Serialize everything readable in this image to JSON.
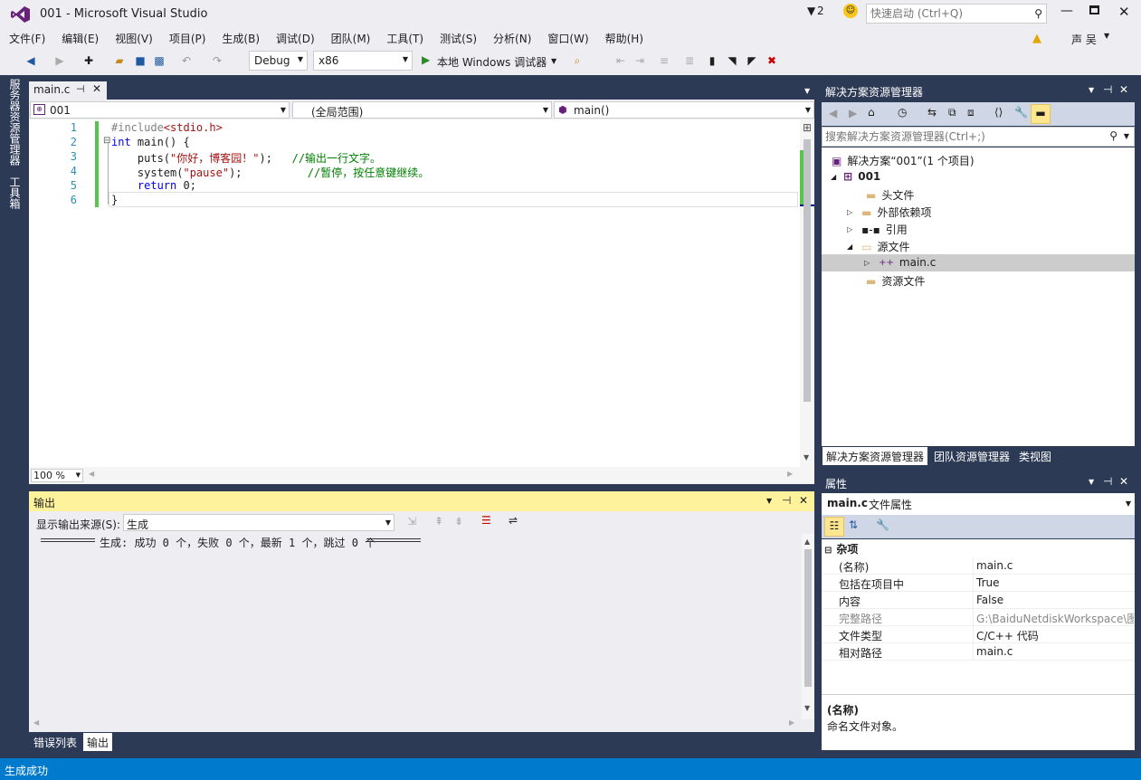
{
  "window": {
    "title": "001 - Microsoft Visual Studio",
    "notif_count": "2",
    "quick_launch_placeholder": "快速启动 (Ctrl+Q)",
    "user": "声 吴"
  },
  "menu": [
    "文件(F)",
    "编辑(E)",
    "视图(V)",
    "项目(P)",
    "生成(B)",
    "调试(D)",
    "团队(M)",
    "工具(T)",
    "测试(S)",
    "分析(N)",
    "窗口(W)",
    "帮助(H)"
  ],
  "toolbar": {
    "config": "Debug",
    "platform": "x86",
    "run_label": "本地 Windows 调试器"
  },
  "left_tabs": [
    "服务器资源管理器",
    "工具箱"
  ],
  "editor": {
    "tab": "main.c",
    "nav_project": "001",
    "nav_scope": "(全局范围)",
    "nav_func": "main()",
    "zoom": "100 %",
    "lines": [
      {
        "n": "1",
        "parts": [
          {
            "t": "#include",
            "c": "pp"
          },
          {
            "t": "<stdio.h>",
            "c": "str"
          }
        ]
      },
      {
        "n": "2",
        "parts": [
          {
            "t": "int",
            "c": "kw"
          },
          {
            "t": " main() {",
            "c": ""
          }
        ]
      },
      {
        "n": "3",
        "parts": [
          {
            "t": "    puts(",
            "c": ""
          },
          {
            "t": "\"你好，博客园！\"",
            "c": "str"
          },
          {
            "t": ");   ",
            "c": ""
          },
          {
            "t": "//输出一行文字。",
            "c": "cm"
          }
        ]
      },
      {
        "n": "4",
        "parts": [
          {
            "t": "    system(",
            "c": ""
          },
          {
            "t": "\"pause\"",
            "c": "str"
          },
          {
            "t": ");          ",
            "c": ""
          },
          {
            "t": "//暂停，按任意键继续。",
            "c": "cm"
          }
        ]
      },
      {
        "n": "5",
        "parts": [
          {
            "t": "    ",
            "c": ""
          },
          {
            "t": "return",
            "c": "kw"
          },
          {
            "t": " 0;",
            "c": ""
          }
        ]
      },
      {
        "n": "6",
        "parts": [
          {
            "t": "}",
            "c": ""
          }
        ]
      }
    ]
  },
  "output": {
    "title": "输出",
    "source_label": "显示输出来源(S):",
    "source": "生成",
    "text": "生成: 成功 0 个，失败 0 个，最新 1 个，跳过 0 个"
  },
  "bottom_tabs": [
    "错误列表",
    "输出"
  ],
  "solution": {
    "title": "解决方案资源管理器",
    "search_placeholder": "搜索解决方案资源管理器(Ctrl+;)",
    "items": [
      "解决方案“001”(1 个项目)",
      "001",
      "头文件",
      "外部依赖项",
      "引用",
      "源文件",
      "main.c",
      "资源文件"
    ],
    "tabs": [
      "解决方案资源管理器",
      "团队资源管理器",
      "类视图"
    ]
  },
  "properties": {
    "title": "属性",
    "object": "main.c",
    "object_type": "文件属性",
    "category": "杂项",
    "rows": [
      {
        "k": "(名称)",
        "v": "main.c"
      },
      {
        "k": "包括在项目中",
        "v": "True"
      },
      {
        "k": "内容",
        "v": "False"
      },
      {
        "k": "完整路径",
        "v": "G:\\BaiduNetdiskWorkspace\\图"
      },
      {
        "k": "文件类型",
        "v": "C/C++ 代码"
      },
      {
        "k": "相对路径",
        "v": "main.c"
      }
    ],
    "desc_title": "(名称)",
    "desc": "命名文件对象。"
  },
  "status": "生成成功"
}
